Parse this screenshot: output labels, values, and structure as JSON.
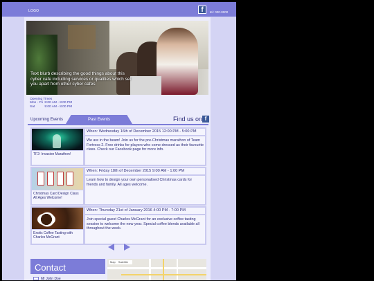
{
  "header": {
    "logo": "LOGO",
    "phone": "tel: 000-0000",
    "facebook_glyph": "f"
  },
  "hero": {
    "blurb": "Text blurb describing the good things about this cyber cafe including services or qualities which set you apart from other cyber cafes"
  },
  "hours": {
    "title": "Opening Times",
    "rows": [
      {
        "days": "Mon - Fri",
        "time": "8:00 AM - 8:00 PM"
      },
      {
        "days": "Sat",
        "time": "9:00 AM - 8:00 PM"
      }
    ]
  },
  "tabs": {
    "upcoming": "Upcoming Events",
    "past": "Past Events",
    "find_us": "Find us on"
  },
  "events": [
    {
      "when": "When: Wednesday 16th of December 2015 12:00 PM - 5:00 PM",
      "description": "We are in the beam! Join us for the pre-Christmas marathon of Team Fortress 2. Free drinks for players who come dressed as their favourite class. Check our Facebook page for more info.",
      "caption": "TF2: Invasion Marathon!"
    },
    {
      "when": "When: Friday 18th of December 2015 9:00 AM - 1:00 PM",
      "description": "Learn how to design your own personalised Christmas cards for friends and family. All ages welcome.",
      "caption": "Christmas Card Design Class All Ages Welcome!"
    },
    {
      "when": "When: Thursday 21st of January 2016 4:00 PM - 7:00 PM",
      "description": "Join special guest Charles McGrant for an exclusive coffee tasting session to welcome the new year. Special coffee blends available all throughout the week.",
      "caption": "Exotic Coffee Tasting with Charles McGrant"
    }
  ],
  "contact": {
    "heading": "Contact",
    "name": "Mr John Doe"
  },
  "map": {
    "controls": [
      "Map",
      "Satellite"
    ]
  },
  "colors": {
    "accent": "#7c7cd8",
    "background": "#d4d4f4",
    "text": "#2c2c7a"
  }
}
